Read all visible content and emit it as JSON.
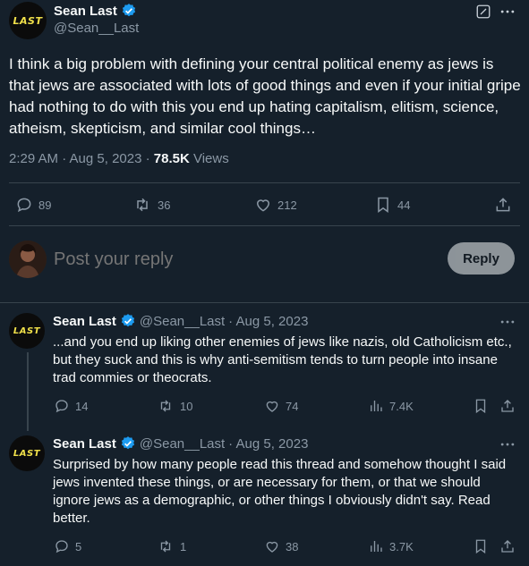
{
  "main_tweet": {
    "author_name": "Sean Last",
    "handle": "@Sean__Last",
    "avatar_text": "LAST",
    "text": "I think a big problem with defining your central political enemy as jews is that jews are associated with lots of good things and even if your initial gripe had nothing to do with this you end up hating capitalism, elitism, science, atheism, skepticism, and similar cool things…",
    "time": "2:29 AM · Aug 5, 2023 · ",
    "views_count": "78.5K",
    "views_label": " Views",
    "replies": "89",
    "retweets": "36",
    "likes": "212",
    "bookmarks": "44"
  },
  "compose": {
    "placeholder": "Post your reply",
    "button_label": "Reply"
  },
  "replies": [
    {
      "author_name": "Sean Last",
      "handle": "@Sean__Last",
      "date": "· Aug 5, 2023",
      "avatar_text": "LAST",
      "text": "...and you end up liking other enemies of jews like nazis, old Catholicism etc., but they suck and this is why anti-semitism tends to turn people into insane trad commies or theocrats.",
      "replies": "14",
      "retweets": "10",
      "likes": "74",
      "views": "7.4K"
    },
    {
      "author_name": "Sean Last",
      "handle": "@Sean__Last",
      "date": "· Aug 5, 2023",
      "avatar_text": "LAST",
      "text": "Surprised by how many people read this thread and somehow thought I said jews invented these things, or are necessary for them, or that we should ignore jews as a demographic, or other things I obviously didn't say. Read better.",
      "replies": "5",
      "retweets": "1",
      "likes": "38",
      "views": "3.7K"
    }
  ],
  "colors": {
    "background": "#15202b",
    "verified": "#1d9bf0",
    "muted": "#8b98a5",
    "divider": "#38444d"
  }
}
